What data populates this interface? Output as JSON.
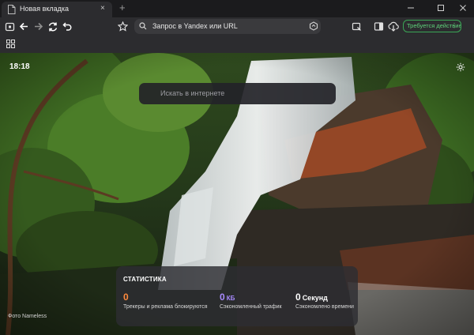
{
  "tab": {
    "title": "Новая вкладка",
    "close": "×"
  },
  "new_tab": "+",
  "window": {
    "minimize": "—",
    "maximize": "☐",
    "close": "✕"
  },
  "address_bar": {
    "text": "Запрос в Yandex или URL"
  },
  "action_button": {
    "label": "Требуется действие"
  },
  "newtab": {
    "clock": "18:18",
    "search": {
      "placeholder": "Искать в интернете"
    },
    "stats": {
      "title": "СТАТИСТИКА",
      "items": [
        {
          "value": "0",
          "unit": "",
          "label": "Трекеры и реклама блокируются",
          "color": "#ff8a3d"
        },
        {
          "value": "0",
          "unit": "КБ",
          "label": "Сэкономленный трафик",
          "color": "#a98bff"
        },
        {
          "value": "0",
          "unit": "Секунд",
          "label": "Сэкономлено времени",
          "color": "#ffffff"
        }
      ]
    },
    "photo_credit": "Фото Nameless"
  },
  "colors": {
    "accent_green": "#3aa655",
    "orange": "#ff8a3d",
    "purple": "#a98bff"
  },
  "icons": [
    "page-icon",
    "close-icon",
    "plus-icon",
    "minimize-icon",
    "maximize-icon",
    "window-close-icon",
    "wallet-icon",
    "back-arrow-icon",
    "forward-arrow-icon",
    "reload-icon",
    "undo-icon",
    "star-icon",
    "search-icon",
    "protect-icon",
    "collections-icon",
    "sidebar-icon",
    "download-icon",
    "apps-grid-icon",
    "gear-icon"
  ]
}
